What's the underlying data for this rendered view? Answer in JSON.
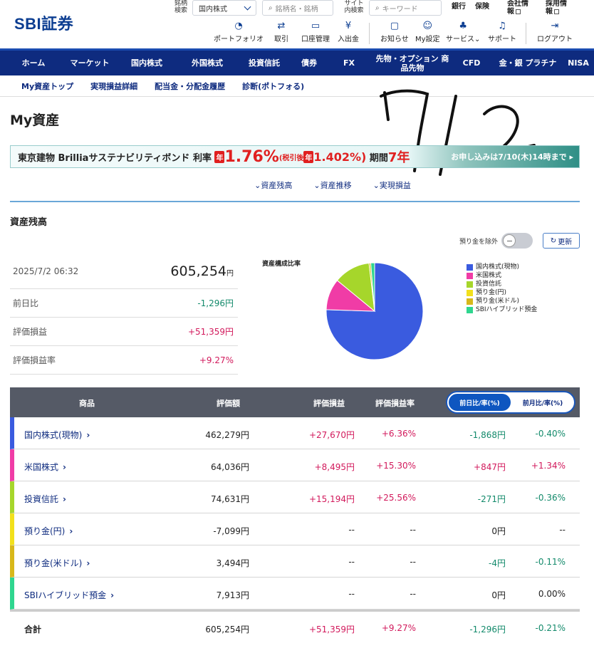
{
  "header": {
    "logo": "SBI証券",
    "stock_search_label": "銘柄検索",
    "market_select": "国内株式",
    "stock_search_placeholder": "銘柄名・銘柄",
    "site_search_label": "サイト内検索",
    "site_search_placeholder": "キーワード",
    "links": [
      "銀行",
      "保険",
      "会社情報",
      "採用情報"
    ],
    "tools": [
      "ポートフォリオ",
      "取引",
      "口座管理",
      "入出金",
      "お知らせ",
      "My設定",
      "サービス",
      "サポート",
      "ログアウト"
    ]
  },
  "nav": [
    "ホーム",
    "マーケット",
    "国内株式",
    "外国株式",
    "投資信託",
    "債券",
    "FX",
    "先物・オプション 商品先物",
    "CFD",
    "金・銀 プラチナ",
    "NISA"
  ],
  "subnav": [
    "My資産トップ",
    "実現損益詳細",
    "配当金・分配金履歴",
    "診断(ポトフォる)"
  ],
  "page_title": "My資産",
  "banner": {
    "text1": "東京建物 Brilliaサステナビリティボンド",
    "text2": "利率",
    "tag1": "年",
    "rate": "1.76%",
    "after_tax": "(税引後",
    "tag2": "年",
    "rate2": "1.402%)",
    "period": "期間",
    "years": "7年",
    "cta": "お申し込みは7/10(木)14時まで ▸"
  },
  "anchors": [
    "資産残高",
    "資産推移",
    "実現損益"
  ],
  "section_title": "資産残高",
  "toggle_label": "預り金を除外",
  "refresh_label": "更新",
  "summary": {
    "datetime": "2025/7/2 06:32",
    "total": "605,254",
    "yen": "円",
    "rows": [
      {
        "label": "前日比",
        "value": "-1,296円"
      },
      {
        "label": "評価損益",
        "value": "+51,359円"
      },
      {
        "label": "評価損益率",
        "value": "+9.27%"
      }
    ]
  },
  "chart_data": {
    "type": "pie",
    "title": "資産構成比率",
    "categories": [
      "国内株式(現物)",
      "米国株式",
      "投資信託",
      "預り金(円)",
      "預り金(米ドル)",
      "SBIハイブリッド預金"
    ],
    "values": [
      462279,
      64036,
      74631,
      0,
      3494,
      7913
    ],
    "colors": [
      "#3a5bdf",
      "#f03ca6",
      "#a6d62b",
      "#f2e01c",
      "#d8b81a",
      "#2fd68f"
    ],
    "legend_position": "right"
  },
  "table": {
    "headers": [
      "商品",
      "評価額",
      "評価損益",
      "評価損益率"
    ],
    "rate_toggle_on": "前日比/率(%)",
    "rate_toggle_off": "前月比/率(%)",
    "rows": [
      {
        "name": "国内株式(現物)",
        "value": "462,279円",
        "pl": "+27,670円",
        "plr": "+6.36%",
        "chg": "-1,868円",
        "chgr": "-0.40%",
        "color": "#3a5bdf"
      },
      {
        "name": "米国株式",
        "value": "64,036円",
        "pl": "+8,495円",
        "plr": "+15.30%",
        "chg": "+847円",
        "chgr": "+1.34%",
        "color": "#f03ca6"
      },
      {
        "name": "投資信託",
        "value": "74,631円",
        "pl": "+15,194円",
        "plr": "+25.56%",
        "chg": "-271円",
        "chgr": "-0.36%",
        "color": "#a6d62b"
      },
      {
        "name": "預り金(円)",
        "value": "-7,099円",
        "pl": "--",
        "plr": "--",
        "chg": "0円",
        "chgr": "--",
        "color": "#f2e01c"
      },
      {
        "name": "預り金(米ドル)",
        "value": "3,494円",
        "pl": "--",
        "plr": "--",
        "chg": "-4円",
        "chgr": "-0.11%",
        "color": "#d8b81a"
      },
      {
        "name": "SBIハイブリッド預金",
        "value": "7,913円",
        "pl": "--",
        "plr": "--",
        "chg": "0円",
        "chgr": "0.00%",
        "color": "#2fd68f"
      }
    ],
    "total": {
      "name": "合計",
      "value": "605,254円",
      "pl": "+51,359円",
      "plr": "+9.27%",
      "chg": "-1,296円",
      "chgr": "-0.21%"
    }
  },
  "handwriting_text": "7/2"
}
